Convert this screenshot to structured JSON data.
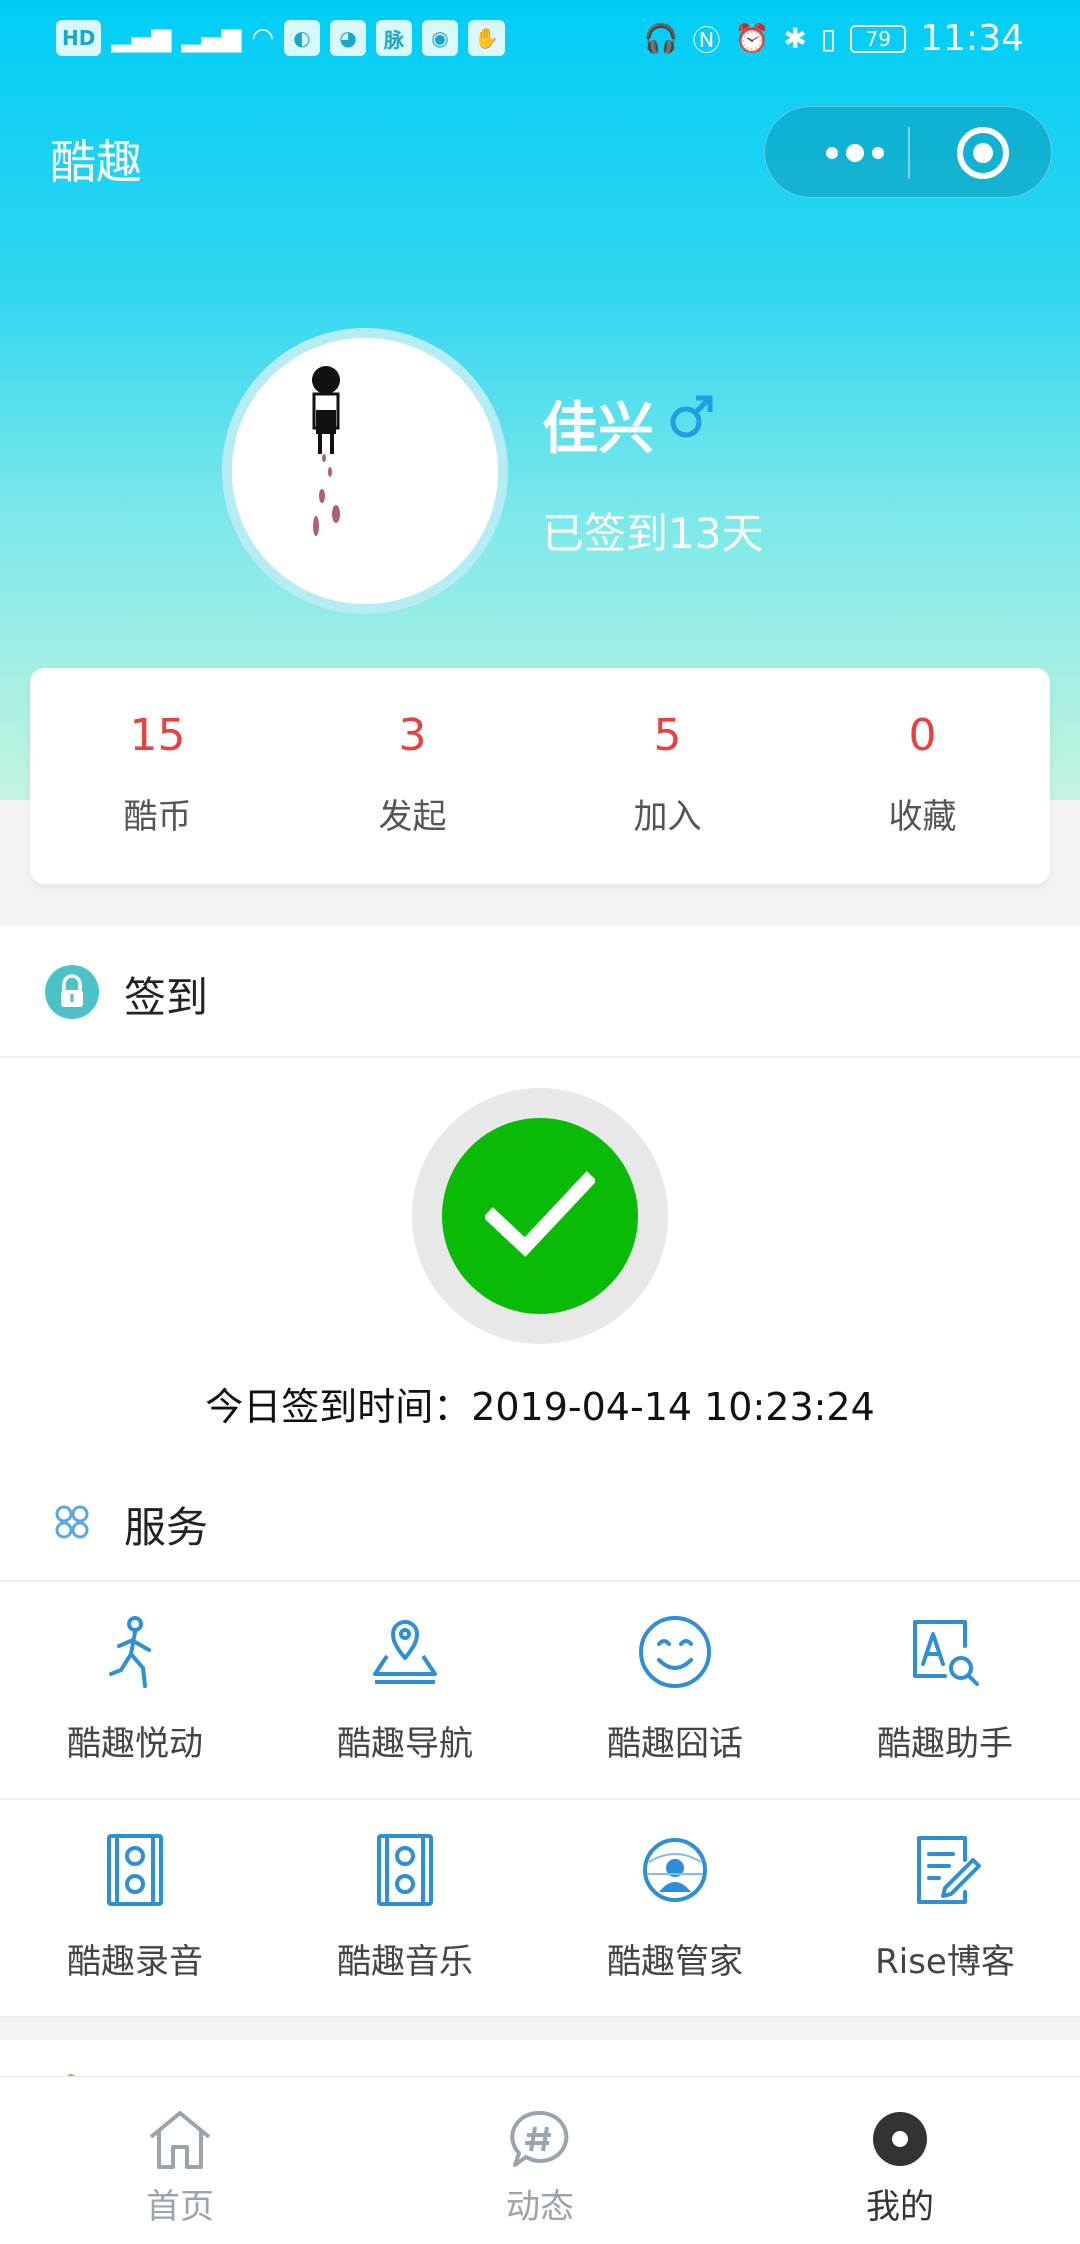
{
  "status_bar": {
    "left_chips": [
      "HD",
      "4G",
      "4G"
    ],
    "app_badges": [
      "脉"
    ],
    "battery": "79",
    "time": "11:34"
  },
  "header": {
    "title": "酷趣"
  },
  "profile": {
    "name": "佳兴",
    "gender_icon": "male-icon",
    "checkin_days": "已签到13天"
  },
  "stats": [
    {
      "value": "15",
      "label": "酷币"
    },
    {
      "value": "3",
      "label": "发起"
    },
    {
      "value": "5",
      "label": "加入"
    },
    {
      "value": "0",
      "label": "收藏"
    }
  ],
  "checkin": {
    "title": "签到",
    "time_text": "今日签到时间：2019-04-14 10:23:24"
  },
  "services": {
    "title": "服务",
    "items": [
      {
        "label": "酷趣悦动",
        "icon": "runner-icon"
      },
      {
        "label": "酷趣导航",
        "icon": "map-pin-icon"
      },
      {
        "label": "酷趣囧话",
        "icon": "smile-icon"
      },
      {
        "label": "酷趣助手",
        "icon": "text-search-icon"
      },
      {
        "label": "酷趣录音",
        "icon": "speaker-icon"
      },
      {
        "label": "酷趣音乐",
        "icon": "speaker-icon"
      },
      {
        "label": "酷趣管家",
        "icon": "butler-icon"
      },
      {
        "label": "Rise博客",
        "icon": "edit-doc-icon"
      }
    ]
  },
  "tabbar": {
    "items": [
      {
        "label": "首页",
        "icon": "home-icon",
        "active": false
      },
      {
        "label": "动态",
        "icon": "hashtag-chat-icon",
        "active": false
      },
      {
        "label": "我的",
        "icon": "profile-dot-icon",
        "active": true
      }
    ]
  },
  "colors": {
    "accent": "#00cdf6",
    "stat_value": "#e64340",
    "check_green": "#09bb07",
    "icon_blue": "#2f8fd6"
  }
}
